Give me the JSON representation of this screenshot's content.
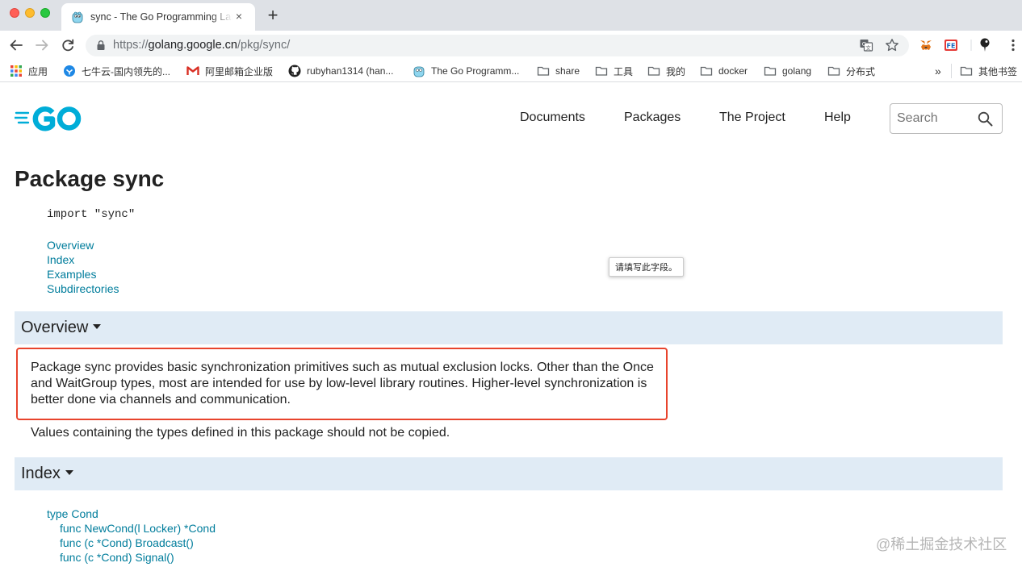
{
  "tab": {
    "title": "sync - The Go Programming Language",
    "close": "×",
    "new_tab": "+"
  },
  "address_bar": {
    "protocol": "https://",
    "host": "golang.google.cn",
    "path": "/pkg/sync/"
  },
  "bookmarks": {
    "apps": "应用",
    "items": [
      "七牛云-国内领先的...",
      "阿里邮箱企业版",
      "rubyhan1314 (han...",
      "The Go Programm...",
      "share",
      "工具",
      "我的",
      "docker",
      "golang",
      "分布式"
    ],
    "more": "»",
    "other": "其他书签"
  },
  "site": {
    "nav": [
      "Documents",
      "Packages",
      "The Project",
      "Help"
    ],
    "search_placeholder": "Search"
  },
  "content": {
    "title": "Package sync",
    "import": "import \"sync\"",
    "toc": [
      "Overview",
      "Index",
      "Examples",
      "Subdirectories"
    ],
    "tooltip": "请填写此字段。",
    "overview": {
      "heading": "Overview",
      "para1": "Package sync provides basic synchronization primitives such as mutual exclusion locks. Other than the Once and WaitGroup types, most are intended for use by low-level library routines. Higher-level synchronization is better done via channels and communication.",
      "para2": "Values containing the types defined in this package should not be copied."
    },
    "index": {
      "heading": "Index",
      "items": [
        "type Cond",
        "func NewCond(l Locker) *Cond",
        "func (c *Cond) Broadcast()",
        "func (c *Cond) Signal()"
      ]
    }
  },
  "watermark": "@稀土掘金技术社区",
  "colors": {
    "link": "#007d9c",
    "section_bg": "#e0ebf5",
    "go_brand": "#00add8",
    "highlight_border": "#e8442d"
  }
}
